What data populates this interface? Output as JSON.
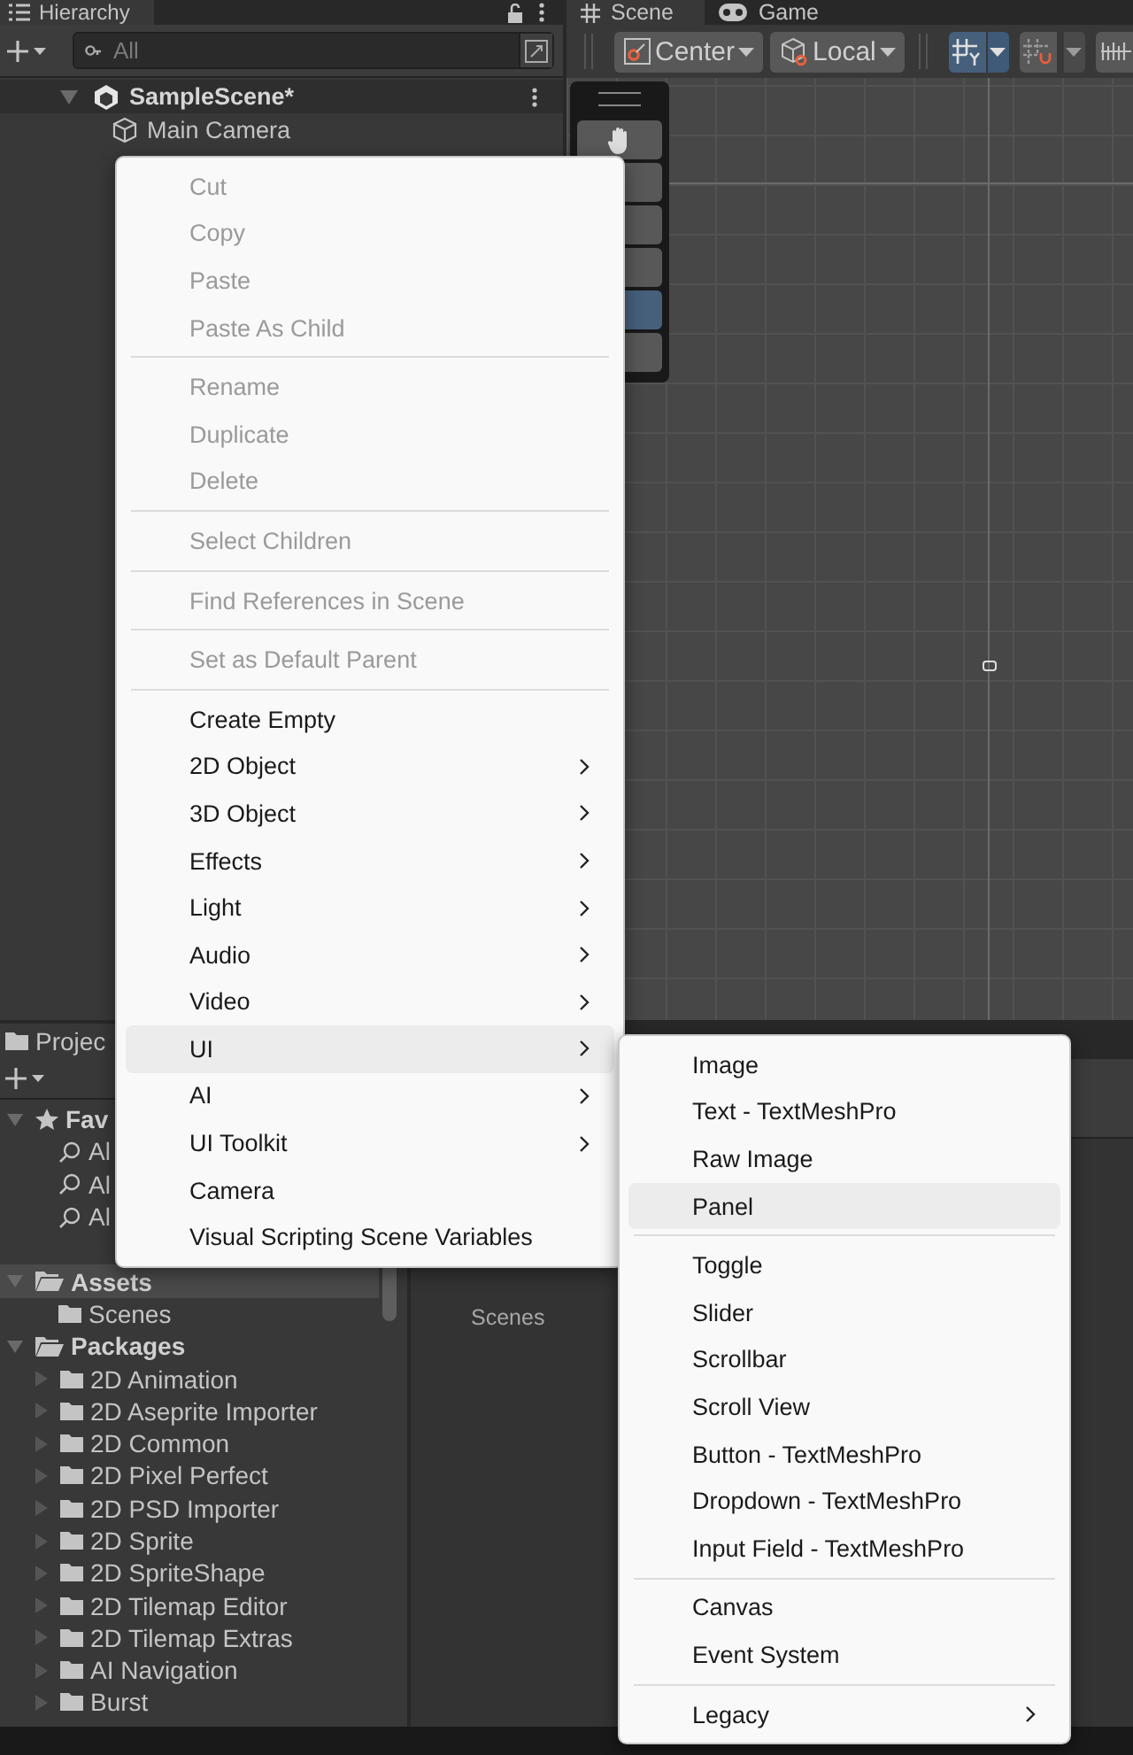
{
  "hierarchy": {
    "tab": "Hierarchy",
    "search": {
      "placeholder": "All"
    },
    "scene": {
      "name": "SampleScene*",
      "expanded": true
    },
    "items": [
      {
        "label": "Main Camera"
      }
    ]
  },
  "scene_view": {
    "tabs": [
      {
        "label": "Scene",
        "selected": true
      },
      {
        "label": "Game",
        "selected": false
      }
    ],
    "toolbar": [
      {
        "label": "Center"
      },
      {
        "label": "Local"
      }
    ]
  },
  "project": {
    "tab": "Projec",
    "tree": [
      {
        "label": "Fav",
        "expanded": true,
        "selected": false,
        "children": [
          {
            "label": "Al",
            "selected": false
          },
          {
            "label": "Al",
            "selected": false
          },
          {
            "label": "Al",
            "selected": false
          }
        ]
      },
      {
        "label": "Assets",
        "expanded": true,
        "selected": true,
        "children": [
          {
            "label": "Scenes",
            "selected": false
          }
        ]
      },
      {
        "label": "Packages",
        "expanded": true,
        "selected": false,
        "children": [
          {
            "label": "2D Animation",
            "expanded": false,
            "selected": false
          },
          {
            "label": "2D Aseprite Importer",
            "expanded": false,
            "selected": false
          },
          {
            "label": "2D Common",
            "expanded": false,
            "selected": false
          },
          {
            "label": "2D Pixel Perfect",
            "expanded": false,
            "selected": false
          },
          {
            "label": "2D PSD Importer",
            "expanded": false,
            "selected": false
          },
          {
            "label": "2D Sprite",
            "expanded": false,
            "selected": false
          },
          {
            "label": "2D SpriteShape",
            "expanded": false,
            "selected": false
          },
          {
            "label": "2D Tilemap Editor",
            "expanded": false,
            "selected": false
          },
          {
            "label": "2D Tilemap Extras",
            "expanded": false,
            "selected": false
          },
          {
            "label": "AI Navigation",
            "expanded": false,
            "selected": false
          },
          {
            "label": "Burst",
            "expanded": false,
            "selected": false
          }
        ]
      }
    ],
    "content": [
      {
        "label": "Scenes"
      }
    ]
  },
  "context_menu": {
    "items": [
      {
        "kind": "item",
        "label": "Cut",
        "disabled": true,
        "submenu": false,
        "selected": false
      },
      {
        "kind": "item",
        "label": "Copy",
        "disabled": true,
        "submenu": false,
        "selected": false
      },
      {
        "kind": "item",
        "label": "Paste",
        "disabled": true,
        "submenu": false,
        "selected": false
      },
      {
        "kind": "item",
        "label": "Paste As Child",
        "disabled": true,
        "submenu": false,
        "selected": false
      },
      {
        "kind": "separator"
      },
      {
        "kind": "item",
        "label": "Rename",
        "disabled": true,
        "submenu": false,
        "selected": false
      },
      {
        "kind": "item",
        "label": "Duplicate",
        "disabled": true,
        "submenu": false,
        "selected": false
      },
      {
        "kind": "item",
        "label": "Delete",
        "disabled": true,
        "submenu": false,
        "selected": false
      },
      {
        "kind": "separator"
      },
      {
        "kind": "item",
        "label": "Select Children",
        "disabled": true,
        "submenu": false,
        "selected": false
      },
      {
        "kind": "separator"
      },
      {
        "kind": "item",
        "label": "Find References in Scene",
        "disabled": true,
        "submenu": false,
        "selected": false
      },
      {
        "kind": "separator"
      },
      {
        "kind": "item",
        "label": "Set as Default Parent",
        "disabled": true,
        "submenu": false,
        "selected": false
      },
      {
        "kind": "separator"
      },
      {
        "kind": "item",
        "label": "Create Empty",
        "disabled": false,
        "submenu": false,
        "selected": false
      },
      {
        "kind": "item",
        "label": "2D Object",
        "disabled": false,
        "submenu": true,
        "selected": false
      },
      {
        "kind": "item",
        "label": "3D Object",
        "disabled": false,
        "submenu": true,
        "selected": false
      },
      {
        "kind": "item",
        "label": "Effects",
        "disabled": false,
        "submenu": true,
        "selected": false
      },
      {
        "kind": "item",
        "label": "Light",
        "disabled": false,
        "submenu": true,
        "selected": false
      },
      {
        "kind": "item",
        "label": "Audio",
        "disabled": false,
        "submenu": true,
        "selected": false
      },
      {
        "kind": "item",
        "label": "Video",
        "disabled": false,
        "submenu": true,
        "selected": false
      },
      {
        "kind": "item",
        "label": "UI",
        "disabled": false,
        "submenu": true,
        "selected": true
      },
      {
        "kind": "item",
        "label": "AI",
        "disabled": false,
        "submenu": true,
        "selected": false
      },
      {
        "kind": "item",
        "label": "UI Toolkit",
        "disabled": false,
        "submenu": true,
        "selected": false
      },
      {
        "kind": "item",
        "label": "Camera",
        "disabled": false,
        "submenu": false,
        "selected": false
      },
      {
        "kind": "item",
        "label": "Visual Scripting Scene Variables",
        "disabled": false,
        "submenu": false,
        "selected": false
      }
    ]
  },
  "submenu": {
    "items": [
      {
        "kind": "item",
        "label": "Image",
        "disabled": false,
        "submenu": false,
        "selected": false
      },
      {
        "kind": "item",
        "label": "Text - TextMeshPro",
        "disabled": false,
        "submenu": false,
        "selected": false
      },
      {
        "kind": "item",
        "label": "Raw Image",
        "disabled": false,
        "submenu": false,
        "selected": false
      },
      {
        "kind": "item",
        "label": "Panel",
        "disabled": false,
        "submenu": false,
        "selected": true
      },
      {
        "kind": "separator"
      },
      {
        "kind": "item",
        "label": "Toggle",
        "disabled": false,
        "submenu": false,
        "selected": false
      },
      {
        "kind": "item",
        "label": "Slider",
        "disabled": false,
        "submenu": false,
        "selected": false
      },
      {
        "kind": "item",
        "label": "Scrollbar",
        "disabled": false,
        "submenu": false,
        "selected": false
      },
      {
        "kind": "item",
        "label": "Scroll View",
        "disabled": false,
        "submenu": false,
        "selected": false
      },
      {
        "kind": "item",
        "label": "Button - TextMeshPro",
        "disabled": false,
        "submenu": false,
        "selected": false
      },
      {
        "kind": "item",
        "label": "Dropdown - TextMeshPro",
        "disabled": false,
        "submenu": false,
        "selected": false
      },
      {
        "kind": "item",
        "label": "Input Field - TextMeshPro",
        "disabled": false,
        "submenu": false,
        "selected": false
      },
      {
        "kind": "separator"
      },
      {
        "kind": "item",
        "label": "Canvas",
        "disabled": false,
        "submenu": false,
        "selected": false
      },
      {
        "kind": "item",
        "label": "Event System",
        "disabled": false,
        "submenu": false,
        "selected": false
      },
      {
        "kind": "separator"
      },
      {
        "kind": "item",
        "label": "Legacy",
        "disabled": false,
        "submenu": true,
        "selected": false
      }
    ]
  }
}
